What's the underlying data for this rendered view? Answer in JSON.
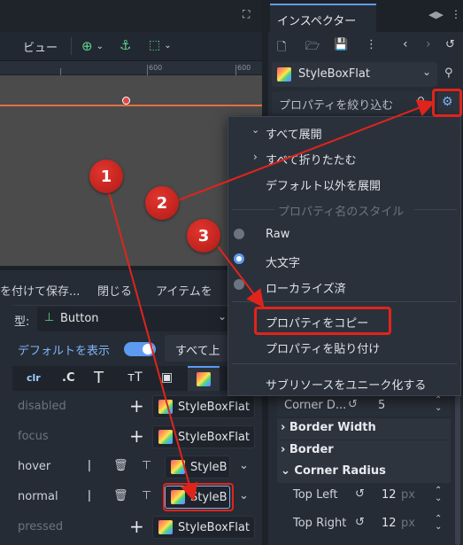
{
  "left_toolbar": {
    "view_label": "ビュー"
  },
  "ruler": {
    "ticks": [
      "600",
      "600"
    ]
  },
  "bottom_toolbar": {
    "save_label": "を付けて保存...",
    "close_label": "閉じる",
    "item_label": "アイテムを"
  },
  "theme_editor": {
    "type_label": "型:",
    "type_value": "Button",
    "show_default_label": "デフォルトを表示",
    "expand_all_label": "すべて上",
    "tab_icons": [
      "clr",
      ".C"
    ],
    "rows": [
      {
        "label": "disabled",
        "value": "StyleBoxFlat"
      },
      {
        "label": "focus",
        "value": "StyleBoxFlat"
      },
      {
        "label": "hover",
        "value": "StyleB"
      },
      {
        "label": "normal",
        "value": "StyleB"
      },
      {
        "label": "pressed",
        "value": "StyleBoxFlat"
      }
    ]
  },
  "inspector": {
    "tab_title": "インスペクター",
    "resource_type": "StyleBoxFlat",
    "filter_placeholder": "プロパティを絞り込む",
    "corner_detail_label": "Corner D...",
    "corner_detail_value": "5",
    "sections": [
      "Border Width",
      "Border",
      "Corner Radius"
    ],
    "top_left_label": "Top Left",
    "top_left_value": "12",
    "top_right_label": "Top Right",
    "top_right_value": "12",
    "unit": "px"
  },
  "popup_menu": {
    "expand_all": "すべて展開",
    "collapse_all": "すべて折りたたむ",
    "expand_non_default": "デフォルト以外を展開",
    "style_header": "プロパティ名のスタイル",
    "raw": "Raw",
    "capitalized": "大文字",
    "localized": "ローカライズ済",
    "copy_properties": "プロパティをコピー",
    "paste_properties": "プロパティを貼り付け",
    "make_unique": "サブリソースをユニーク化する"
  },
  "annotations": {
    "badge1": "1",
    "badge2": "2",
    "badge3": "3"
  },
  "colors": {
    "accent": "#5d9bf0",
    "annotation_red": "#e0241b",
    "popup_bg": "#2b313b"
  }
}
